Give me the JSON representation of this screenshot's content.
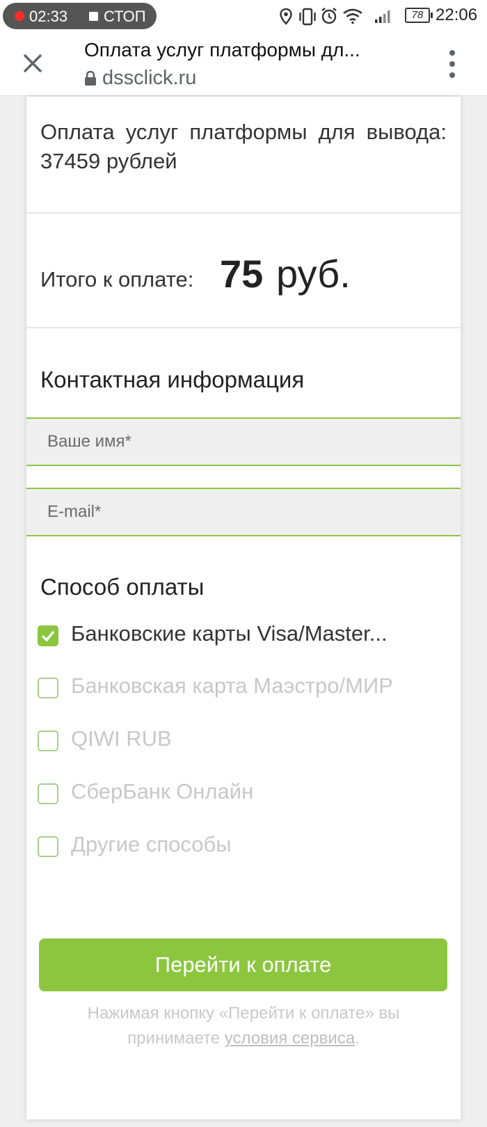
{
  "status_bar": {
    "recording_time": "02:33",
    "recording_stop": "СТОП",
    "battery": "78",
    "clock": "22:06"
  },
  "browser": {
    "page_title": "Оплата услуг платформы дл...",
    "url": "dssclick.ru"
  },
  "order": {
    "description": "Оплата услуг платформы для вывода: 37459 рублей",
    "total_label": "Итого к оплате:",
    "total_amount": "75",
    "total_currency": "руб."
  },
  "contact": {
    "title": "Контактная информация",
    "name_placeholder": "Ваше имя*",
    "email_placeholder": "E-mail*"
  },
  "payment": {
    "title": "Способ оплаты",
    "methods": [
      {
        "label": "Банковские карты Visa/Master...",
        "checked": true
      },
      {
        "label": "Банковская карта Маэстро/МИР",
        "checked": false
      },
      {
        "label": "QIWI RUB",
        "checked": false
      },
      {
        "label": "СберБанк Онлайн",
        "checked": false
      },
      {
        "label": "Другие способы",
        "checked": false
      }
    ],
    "submit_label": "Перейти к оплате",
    "terms_prefix": "Нажимая кнопку «Перейти к оплате» вы принимаете",
    "terms_link": "условия сервиса",
    "terms_suffix": "."
  },
  "colors": {
    "accent": "#8cc63f",
    "field_bg": "#efefef",
    "muted_text": "#c8c8c8"
  }
}
